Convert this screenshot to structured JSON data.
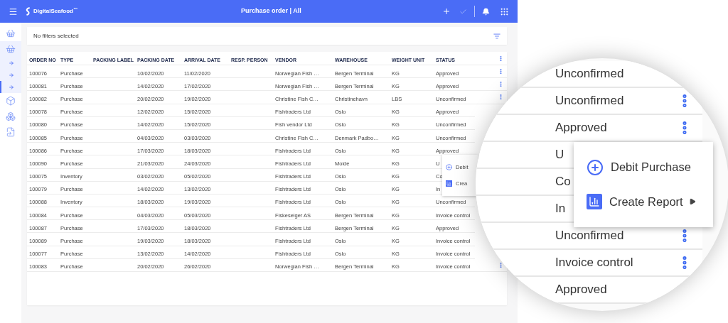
{
  "header": {
    "logo": "DigitalSeafood$^{™}$",
    "title": "Purchase order | All",
    "confirm_disabled": true
  },
  "sidebar": {
    "items": [
      {
        "selected": false
      },
      {
        "selected": false,
        "expanded": true,
        "children": [
          {
            "selected": false
          },
          {
            "selected": false
          },
          {
            "selected": true
          }
        ]
      },
      {
        "selected": false
      },
      {
        "selected": false
      },
      {
        "selected": false
      }
    ]
  },
  "filter_bar": {
    "text": "No filters selected"
  },
  "table": {
    "columns": [
      "ORDER NO",
      "TYPE",
      "PACKING LABEL",
      "PACKING DATE",
      "ARRIVAL DATE",
      "RESP. PERSON",
      "VENDOR",
      "WAREHOUSE",
      "WEIGHT UNIT",
      "STATUS"
    ],
    "rows": [
      {
        "order_no": "100076",
        "type": "Purchase",
        "packing_date": "10/02/2020",
        "arrival_date": "11/02/2020",
        "vendor": "Norwegian Fish …",
        "warehouse": "Bergen Terminal",
        "weight_unit": "KG",
        "status": "Approved",
        "has_menu": true
      },
      {
        "order_no": "100081",
        "type": "Purchase",
        "packing_date": "14/02/2020",
        "arrival_date": "17/02/2020",
        "vendor": "Norwegian Fish …",
        "warehouse": "Bergen Terminal",
        "weight_unit": "KG",
        "status": "Approved",
        "has_menu": true
      },
      {
        "order_no": "100082",
        "type": "Purchase",
        "packing_date": "20/02/2020",
        "arrival_date": "19/02/2020",
        "vendor": "Christine Fish C…",
        "warehouse": "Christinehavn",
        "weight_unit": "LBS",
        "status": "Unconfirmed",
        "has_menu": true
      },
      {
        "order_no": "100078",
        "type": "Purchase",
        "packing_date": "12/02/2020",
        "arrival_date": "15/02/2020",
        "vendor": "Fishtraders Ltd",
        "warehouse": "Oslo",
        "weight_unit": "KG",
        "status": "Approved",
        "has_menu": false
      },
      {
        "order_no": "100080",
        "type": "Purchase",
        "packing_date": "14/02/2020",
        "arrival_date": "15/02/2020",
        "vendor": "Fish vendor Ltd",
        "warehouse": "Oslo",
        "weight_unit": "KG",
        "status": "Unconfirmed",
        "has_menu": false
      },
      {
        "order_no": "100085",
        "type": "Purchase",
        "packing_date": "04/03/2020",
        "arrival_date": "03/03/2020",
        "vendor": "Christine Fish C…",
        "warehouse": "Denmark Padbo…",
        "weight_unit": "KG",
        "status": "Unconfirmed",
        "has_menu": false
      },
      {
        "order_no": "100086",
        "type": "Purchase",
        "packing_date": "17/03/2020",
        "arrival_date": "18/03/2020",
        "vendor": "Fishtraders Ltd",
        "warehouse": "Oslo",
        "weight_unit": "KG",
        "status": "Approved",
        "has_menu": false
      },
      {
        "order_no": "100090",
        "type": "Purchase",
        "packing_date": "21/03/2020",
        "arrival_date": "24/03/2020",
        "vendor": "Fishtraders Ltd",
        "warehouse": "Molde",
        "weight_unit": "KG",
        "status": "U",
        "has_menu": false
      },
      {
        "order_no": "100075",
        "type": "Inventory",
        "packing_date": "03/02/2020",
        "arrival_date": "05/02/2020",
        "vendor": "Fishtraders Ltd",
        "warehouse": "Oslo",
        "weight_unit": "KG",
        "status": "Co",
        "has_menu": false
      },
      {
        "order_no": "100079",
        "type": "Purchase",
        "packing_date": "14/02/2020",
        "arrival_date": "13/02/2020",
        "vendor": "Fishtraders Ltd",
        "warehouse": "Oslo",
        "weight_unit": "KG",
        "status": "In",
        "has_menu": false
      },
      {
        "order_no": "100088",
        "type": "Inventory",
        "packing_date": "18/03/2020",
        "arrival_date": "19/03/2020",
        "vendor": "Fishtraders Ltd",
        "warehouse": "Oslo",
        "weight_unit": "KG",
        "status": "Unconfirmed",
        "has_menu": false
      },
      {
        "order_no": "100084",
        "type": "Purchase",
        "packing_date": "04/03/2020",
        "arrival_date": "05/03/2020",
        "vendor": "Fiskeselger AS",
        "warehouse": "Bergen Terminal",
        "weight_unit": "KG",
        "status": "Invoice control",
        "has_menu": false
      },
      {
        "order_no": "100087",
        "type": "Purchase",
        "packing_date": "17/03/2020",
        "arrival_date": "18/03/2020",
        "vendor": "Fishtraders Ltd",
        "warehouse": "Bergen Terminal",
        "weight_unit": "KG",
        "status": "Approved",
        "has_menu": false
      },
      {
        "order_no": "100089",
        "type": "Purchase",
        "packing_date": "19/03/2020",
        "arrival_date": "18/03/2020",
        "vendor": "Fishtraders Ltd",
        "warehouse": "Oslo",
        "weight_unit": "KG",
        "status": "Invoice control",
        "has_menu": false
      },
      {
        "order_no": "100077",
        "type": "Purchase",
        "packing_date": "13/02/2020",
        "arrival_date": "14/02/2020",
        "vendor": "Fishtraders Ltd",
        "warehouse": "Oslo",
        "weight_unit": "KG",
        "status": "Invoice control",
        "has_menu": false
      },
      {
        "order_no": "100083",
        "type": "Purchase",
        "packing_date": "20/02/2020",
        "arrival_date": "26/02/2020",
        "vendor": "Norwegian Fish …",
        "warehouse": "Bergen Terminal",
        "weight_unit": "KG",
        "status": "Invoice control",
        "has_menu": true
      }
    ],
    "context_menu": {
      "items": [
        {
          "label": "Debit"
        },
        {
          "label": "Crea"
        }
      ]
    }
  },
  "magnifier": {
    "rows": [
      {
        "status": "Unconfirmed"
      },
      {
        "status": "Unconfirmed",
        "has_menu": true
      },
      {
        "status": "Approved",
        "has_menu": true
      },
      {
        "status": "U"
      },
      {
        "status": "Co"
      },
      {
        "status": "In"
      },
      {
        "status": "Unconfirmed",
        "has_menu": true
      },
      {
        "status": "Invoice control",
        "has_menu": true
      },
      {
        "status": "Approved"
      }
    ],
    "menu": {
      "items": [
        {
          "label": "Debit Purchase",
          "has_submenu": false
        },
        {
          "label": "Create Report",
          "has_submenu": true
        }
      ]
    }
  }
}
